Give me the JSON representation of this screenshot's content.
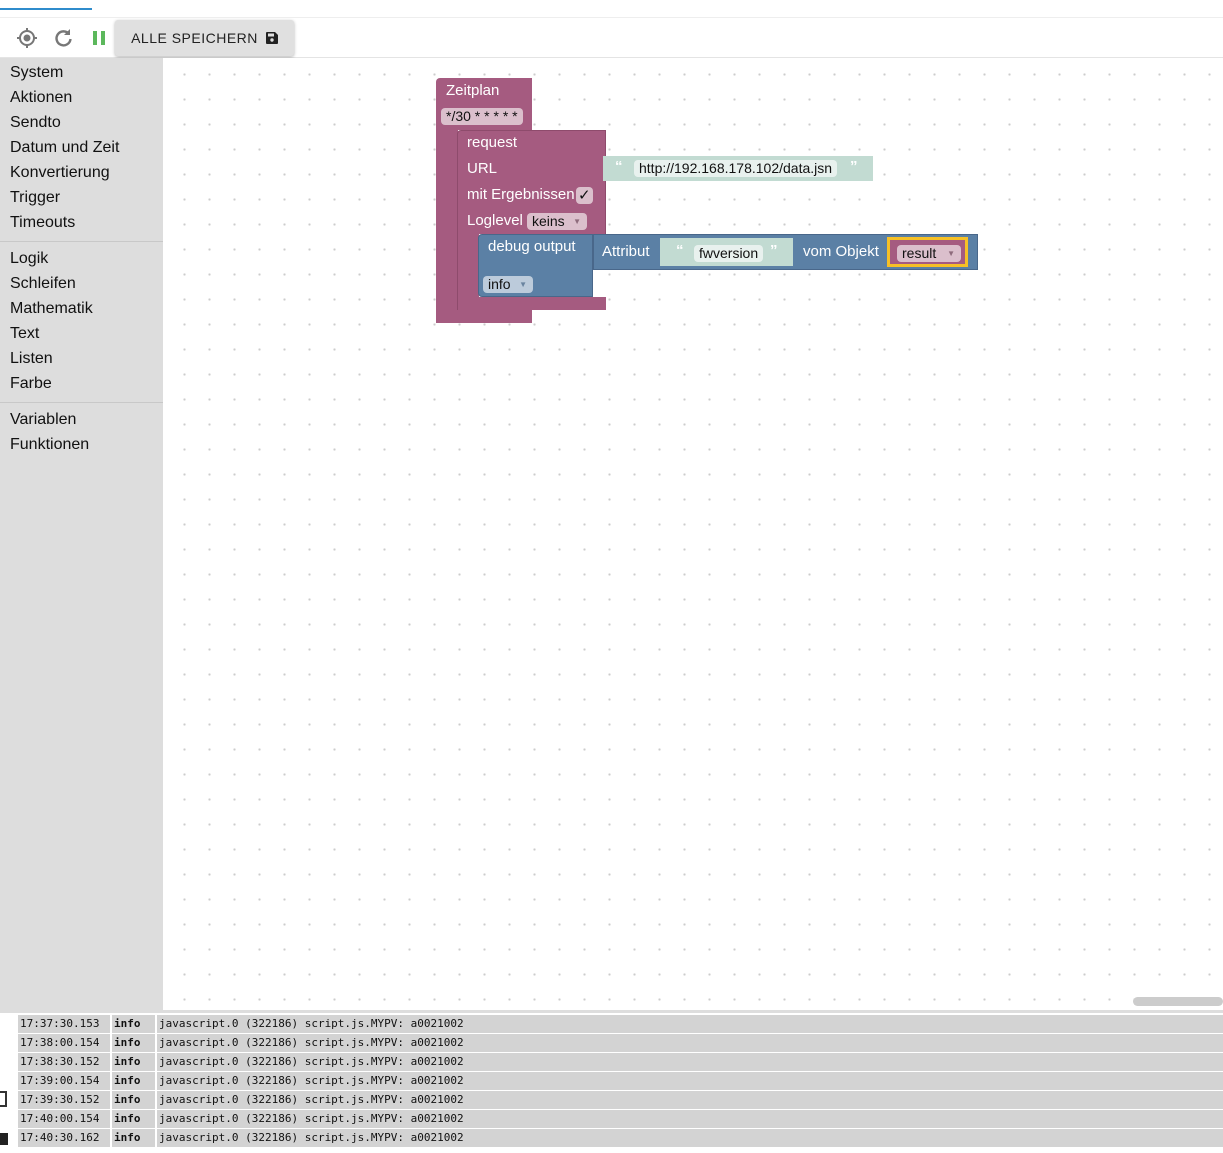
{
  "toolbar": {
    "save_label": "ALLE SPEICHERN",
    "icons": [
      "locate-icon",
      "refresh-icon",
      "pause-icon",
      "save-icon"
    ],
    "pause_color": "#5cb85c"
  },
  "sidebar": {
    "groups": [
      [
        "System",
        "Aktionen",
        "Sendto",
        "Datum und Zeit",
        "Konvertierung",
        "Trigger",
        "Timeouts"
      ],
      [
        "Logik",
        "Schleifen",
        "Mathematik",
        "Text",
        "Listen",
        "Farbe"
      ],
      [
        "Variablen",
        "Funktionen"
      ]
    ]
  },
  "blocks": {
    "schedule": {
      "title": "Zeitplan",
      "cron": "*/30 * * * * *",
      "color": "#a55b80"
    },
    "request": {
      "title": "request",
      "url_label": "URL",
      "url": "http://192.168.178.102/data.jsn",
      "results_label": "mit Ergebnissen",
      "results_checked": "✓",
      "loglevel_label": "Loglevel",
      "loglevel": "keins"
    },
    "debug": {
      "title": "debug output",
      "level": "info",
      "color": "#5b80a5"
    },
    "attribute": {
      "label": "Attribut",
      "name": "fwversion",
      "of_label": "vom Objekt",
      "object": "result"
    }
  },
  "log": [
    {
      "time": "17:37:30.153",
      "level": "info",
      "msg": "javascript.0 (322186) script.js.MYPV: a0021002"
    },
    {
      "time": "17:38:00.154",
      "level": "info",
      "msg": "javascript.0 (322186) script.js.MYPV: a0021002"
    },
    {
      "time": "17:38:30.152",
      "level": "info",
      "msg": "javascript.0 (322186) script.js.MYPV: a0021002"
    },
    {
      "time": "17:39:00.154",
      "level": "info",
      "msg": "javascript.0 (322186) script.js.MYPV: a0021002"
    },
    {
      "time": "17:39:30.152",
      "level": "info",
      "msg": "javascript.0 (322186) script.js.MYPV: a0021002"
    },
    {
      "time": "17:40:00.154",
      "level": "info",
      "msg": "javascript.0 (322186) script.js.MYPV: a0021002"
    },
    {
      "time": "17:40:30.162",
      "level": "info",
      "msg": "javascript.0 (322186) script.js.MYPV: a0021002"
    }
  ]
}
